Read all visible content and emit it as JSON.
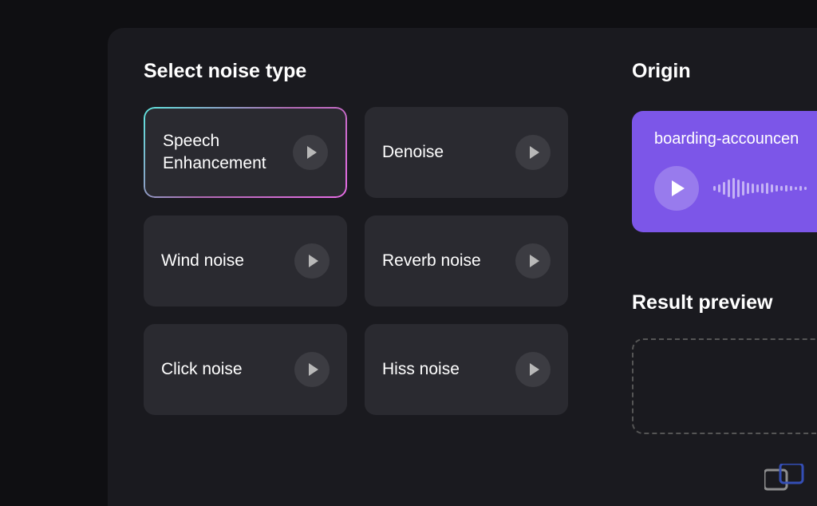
{
  "sections": {
    "noise_type_title": "Select noise type",
    "origin_title": "Origin",
    "result_title": "Result preview"
  },
  "noise_cards": [
    {
      "label": "Speech Enhancement",
      "selected": true
    },
    {
      "label": "Denoise",
      "selected": false
    },
    {
      "label": "Wind noise",
      "selected": false
    },
    {
      "label": "Reverb noise",
      "selected": false
    },
    {
      "label": "Click noise",
      "selected": false
    },
    {
      "label": "Hiss noise",
      "selected": false
    }
  ],
  "origin": {
    "filename": "boarding-accouncen"
  },
  "waveform_heights": [
    6,
    10,
    16,
    22,
    26,
    22,
    18,
    14,
    12,
    10,
    12,
    14,
    10,
    8,
    6,
    8,
    6,
    4,
    6,
    4
  ]
}
